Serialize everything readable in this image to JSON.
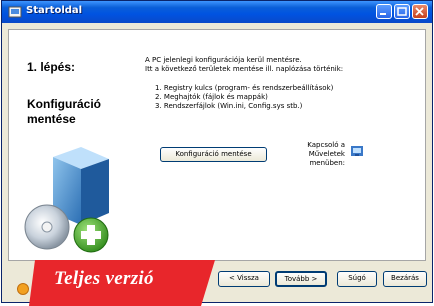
{
  "window": {
    "title": "Startoldal"
  },
  "wizard": {
    "step_label": "1. lépés:",
    "section_title": "Konfiguráció mentése",
    "intro_lines": [
      "A PC jelenlegi konfigurációja kerül mentésre.",
      "Itt a következő területek mentése ill. naplózása történik:"
    ],
    "items": [
      "1. Registry kulcs (program- és rendszerbeállítások)",
      "2. Meghajtók (fájlok és mappák)",
      "3. Rendszerfájlok (Win.ini, Config.sys stb.)"
    ],
    "backup_button_label": "Konfiguráció mentése",
    "shortcut_label": "Kapcsoló a Műveletek menüben:"
  },
  "footer": {
    "back_label": "< Vissza",
    "next_label": "Tovább >",
    "help_label": "Súgó",
    "exit_label": "Bezárás"
  },
  "banner": {
    "text": "Teljes verzió",
    "color": "#e8262b"
  },
  "colors": {
    "titlebar": "#0053e1",
    "window_bg": "#ece9d8"
  }
}
